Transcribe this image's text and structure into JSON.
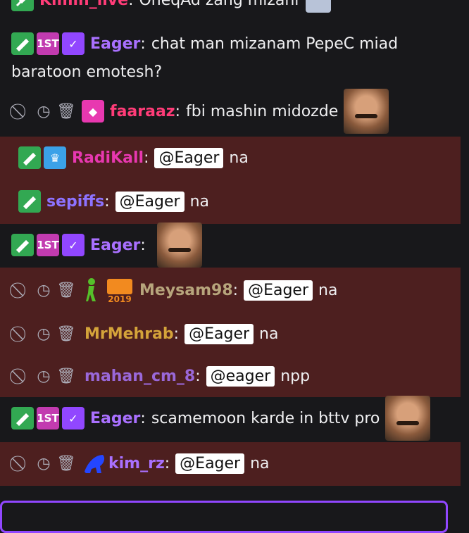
{
  "colors": {
    "bg": "#18181b",
    "highlight": "#4d1f1f",
    "mention_bg": "#ffffff",
    "input_border": "#9147ff"
  },
  "messages": [
    {
      "user": "Kimin_live",
      "text": "OneqAd zang mizani",
      "color": "#ff3c78"
    },
    {
      "user": "Eager",
      "text": "chat man mizanam PepeC miad baratoon emotesh?",
      "color": "#a970ff"
    },
    {
      "user": "faaraaz",
      "text": "fbi mashin midozde",
      "color": "#ff3c78"
    },
    {
      "user": "RadiKall",
      "mention": "@Eager",
      "text": "na",
      "color": "#e838b0"
    },
    {
      "user": "sepiffs",
      "mention": "@Eager",
      "text": "na",
      "color": "#8d72ff"
    },
    {
      "user": "Eager",
      "text": "",
      "color": "#a970ff"
    },
    {
      "user": "Meysam98",
      "mention": "@Eager",
      "text": "na",
      "color": "#b7a57c"
    },
    {
      "user": "MrMehrab",
      "mention": "@Eager",
      "text": "na",
      "color": "#d4a33a"
    },
    {
      "user": "mahan_cm_8",
      "mention": "@eager",
      "text": "npp",
      "color": "#9a68d9"
    },
    {
      "user": "Eager",
      "text": "scamemoon karde in bttv pro",
      "color": "#a970ff"
    },
    {
      "user": "kim_rz",
      "mention": "@Eager",
      "text": "na",
      "color": "#a970ff"
    }
  ],
  "badges": {
    "first": "1ST",
    "year": "2019"
  },
  "icons": [
    "ban-icon",
    "timeout-icon",
    "delete-icon",
    "moderator-icon",
    "verified-icon",
    "vip-icon",
    "crown-icon"
  ]
}
